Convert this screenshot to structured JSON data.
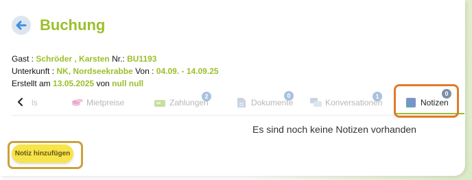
{
  "header": {
    "title": "Buchung"
  },
  "booking": {
    "guest_label": "Gast :",
    "guest_name": "Schröder , Karsten",
    "number_label": "Nr.:",
    "number": "BU1193",
    "accommodation_label": "Unterkunft :",
    "accommodation": "NK, Nordseekrabbe",
    "from_label": "Von :",
    "date_range": "04.09. - 14.09.25",
    "created_label": "Erstellt am",
    "created_date": "13.05.2025",
    "by_label": "von",
    "created_by": "null null"
  },
  "tabs": {
    "partial_label": "ls",
    "items": [
      {
        "label": "Mietpreise",
        "icon": "coins-icon"
      },
      {
        "label": "Zahlungen",
        "icon": "payment-icon",
        "badge": "2"
      },
      {
        "label": "Dokumente",
        "icon": "document-icon",
        "badge": "0"
      },
      {
        "label": "Konversationen",
        "icon": "chat-icon",
        "badge": "1"
      },
      {
        "label": "Notizen",
        "icon": "notes-icon",
        "badge": "0",
        "active": true
      }
    ]
  },
  "notes": {
    "empty_message": "Es sind noch keine Notizen vorhanden",
    "add_button": "Notiz hinzufügen"
  },
  "colors": {
    "accent_green": "#9bbf2a",
    "button_yellow": "#f6e44a",
    "highlight_orange": "#e07a2c",
    "highlight_gold": "#c9a13d"
  }
}
